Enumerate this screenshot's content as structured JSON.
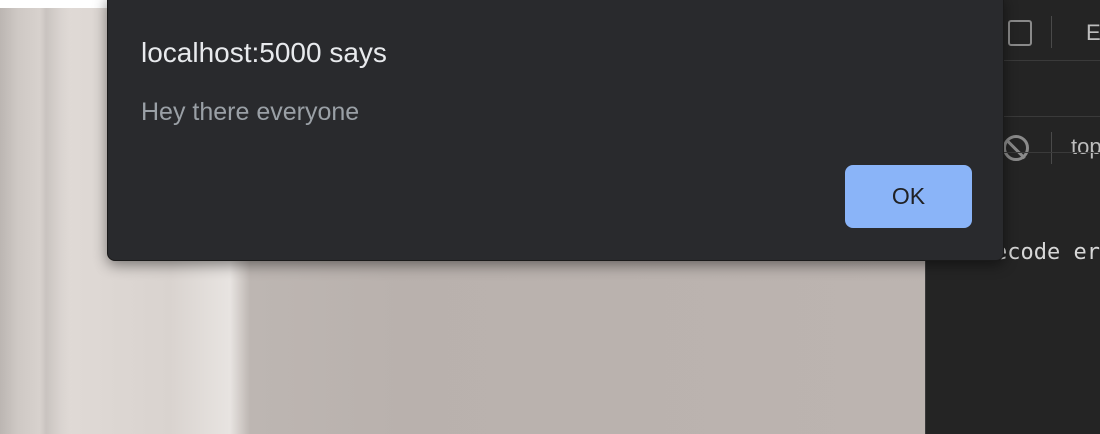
{
  "dialog": {
    "title": "localhost:5000 says",
    "message": "Hey there everyone",
    "ok_label": "OK"
  },
  "devtools": {
    "tab_label": "E",
    "context_selector": "top",
    "console_line": "ecode er",
    "icons": [
      "device-toggle-icon",
      "clear-console-icon"
    ]
  },
  "colors": {
    "dialog_bg": "#292a2d",
    "title_text": "#e8eaed",
    "message_text": "#9aa0a6",
    "ok_button_bg": "#8ab4f8",
    "devtools_bg": "#242424"
  }
}
